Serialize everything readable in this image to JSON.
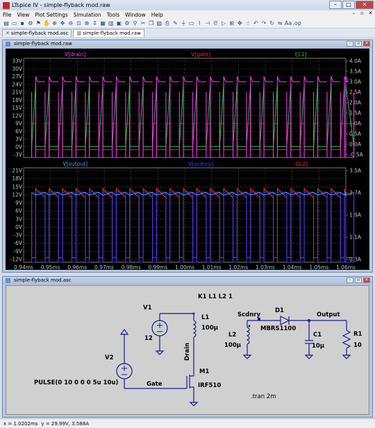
{
  "app": {
    "title": "LTspice IV - simple-flyback mod.raw"
  },
  "menu": [
    "File",
    "View",
    "Plot Settings",
    "Simulation",
    "Tools",
    "Window",
    "Help"
  ],
  "tabs": [
    {
      "label": "simple-flyback mod.asc"
    },
    {
      "label": "simple-flyback mod.raw"
    }
  ],
  "waveform_window": {
    "title": "simple-flyback mod.raw",
    "panes": [
      {
        "traces": [
          {
            "name": "V[drain]",
            "color": "#ff40ff"
          },
          {
            "name": "V[gate]",
            "color": "#e03030"
          },
          {
            "name": "I[L1]",
            "color": "#20c040"
          }
        ],
        "left_ticks": [
          "33V",
          "30V",
          "27V",
          "24V",
          "21V",
          "18V",
          "15V",
          "12V",
          "9V",
          "6V",
          "3V",
          "0V",
          "-3V"
        ],
        "right_ticks": [
          "4.0A",
          "3.5A",
          "3.0A",
          "2.5A",
          "2.0A",
          "1.5A",
          "1.0A",
          "0.5A",
          "0.0A",
          "-0.5A"
        ]
      },
      {
        "traces": [
          {
            "name": "V[output]",
            "color": "#40a0ff"
          },
          {
            "name": "V[scdnry]",
            "color": "#4040ff"
          },
          {
            "name": "-I[L2]",
            "color": "#ff3030"
          }
        ],
        "left_ticks": [
          "21V",
          "18V",
          "15V",
          "12V",
          "9V",
          "6V",
          "3V",
          "0V",
          "-3V",
          "-6V",
          "-9V",
          "-12V"
        ],
        "right_ticks": [
          "3.5A",
          "2.7A",
          "1.9A",
          "1.1A",
          "0.3A"
        ]
      }
    ],
    "x_ticks": [
      "0.94ms",
      "0.95ms",
      "0.96ms",
      "0.97ms",
      "0.98ms",
      "0.99ms",
      "1.00ms",
      "1.01ms",
      "1.02ms",
      "1.03ms",
      "1.04ms",
      "1.05ms",
      "1.06ms"
    ]
  },
  "chart_data": [
    {
      "type": "line",
      "x_range_ms": [
        0.94,
        1.06
      ],
      "period_us": 5,
      "duty_us": 1.5,
      "ylim_left_V": [
        -3,
        35
      ],
      "ylim_right_A": [
        -0.5,
        4.0
      ],
      "series": [
        {
          "name": "V[drain]",
          "axis": "left",
          "low": -3,
          "high": 26,
          "unit": "V"
        },
        {
          "name": "V[gate]",
          "axis": "left",
          "low": 0,
          "high": 10,
          "unit": "V"
        },
        {
          "name": "I[L1]",
          "axis": "right",
          "low": 0,
          "high": 2.8,
          "unit": "A"
        }
      ]
    },
    {
      "type": "line",
      "x_range_ms": [
        0.94,
        1.06
      ],
      "period_us": 5,
      "ylim_left_V": [
        -12,
        21
      ],
      "ylim_right_A": [
        -0.2,
        3.9
      ],
      "series": [
        {
          "name": "V[output]",
          "axis": "left",
          "value": 12,
          "unit": "V"
        },
        {
          "name": "V[scdnry]",
          "axis": "left",
          "low": -12,
          "high": 12.5,
          "unit": "V"
        },
        {
          "name": "-I[L2]",
          "axis": "right",
          "low": 0,
          "high": 2.6,
          "unit": "A"
        }
      ]
    }
  ],
  "schematic_window": {
    "title": "simple-flyback mod.asc",
    "labels": {
      "coupling": "K1 L1 L2 1",
      "v1_name": "V1",
      "v1_value": "12",
      "l1_name": "L1",
      "l1_value": "100µ",
      "v2_name": "V2",
      "v2_value": "PULSE(0 10 0 0 0 5u 10u)",
      "drain": "Drain",
      "gate": "Gate",
      "m1_name": "M1",
      "m1_value": "IRF510",
      "scdnry": "Scdnry",
      "l2_name": "L2",
      "l2_value": "100µ",
      "d1_name": "D1",
      "d1_value": "MBRS1100",
      "c1_name": "C1",
      "c1_value": "10µ",
      "output": "Output",
      "r1_name": "R1",
      "r1_value": "10",
      "tran": ".tran 2m"
    }
  },
  "status": {
    "x": "x = 1.0202ms",
    "y": "y = 29.99V, 3.588A"
  }
}
